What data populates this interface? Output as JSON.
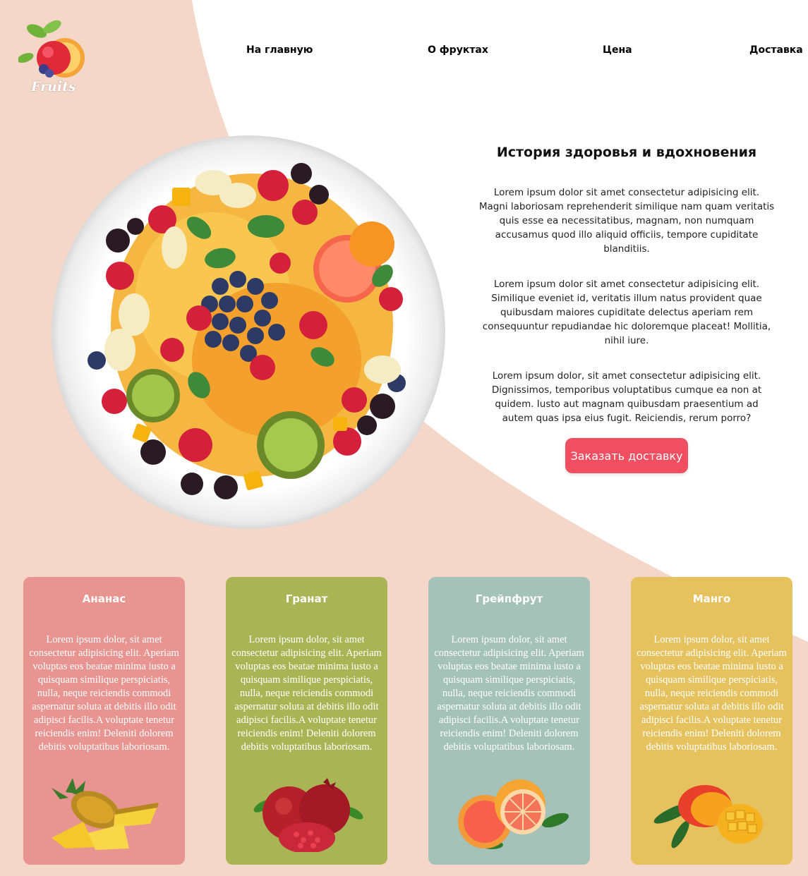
{
  "logo": {
    "text": "Fruits"
  },
  "nav": {
    "items": [
      {
        "label": "На главную"
      },
      {
        "label": "О фруктах"
      },
      {
        "label": "Цена"
      },
      {
        "label": "Доставка"
      }
    ]
  },
  "hero": {
    "title": "История здоровья и вдохновения",
    "paragraphs": [
      "Lorem ipsum dolor sit amet consectetur adipisicing elit. Magni laboriosam reprehenderit similique nam quam veritatis quis esse ea necessitatibus, magnam, non numquam accusamus quod illo aliquid officiis, tempore cupiditate blanditiis.",
      "Lorem ipsum dolor sit amet consectetur adipisicing elit. Similique eveniet id, veritatis illum natus provident quae quibusdam maiores cupiditate delectus aperiam rem consequuntur repudiandae hic doloremque placeat! Mollitia, nihil iure.",
      "Lorem ipsum dolor, sit amet consectetur adipisicing elit. Dignissimos, temporibus voluptatibus cumque ea non at quidem. Iusto aut magnam quibusdam praesentium ad autem quas ipsa eius fugit. Reiciendis, rerum porro?"
    ],
    "button_label": "Заказать доставку"
  },
  "cards": [
    {
      "title": "Ананас",
      "color": "#e89490",
      "text": "Lorem ipsum dolor, sit amet consectetur adipisicing elit. Aperiam voluptas eos beatae minima iusto a quisquam similique perspiciatis, nulla, neque reiciendis commodi aspernatur soluta at debitis illo odit adipisci facilis.A voluptate tenetur reiciendis enim! Deleniti dolorem debitis voluptatibus laboriosam.",
      "icon": "pineapple-image"
    },
    {
      "title": "Гранат",
      "color": "#a9b554",
      "text": "Lorem ipsum dolor, sit amet consectetur adipisicing elit. Aperiam voluptas eos beatae minima iusto a quisquam similique perspiciatis, nulla, neque reiciendis commodi aspernatur soluta at debitis illo odit adipisci facilis.A voluptate tenetur reiciendis enim! Deleniti dolorem debitis voluptatibus laboriosam.",
      "icon": "pomegranate-image"
    },
    {
      "title": "Грейпфрут",
      "color": "#a4c2b8",
      "text": "Lorem ipsum dolor, sit amet consectetur adipisicing elit. Aperiam voluptas eos beatae minima iusto a quisquam similique perspiciatis, nulla, neque reiciendis commodi aspernatur soluta at debitis illo odit adipisci facilis.A voluptate tenetur reiciendis enim! Deleniti dolorem debitis voluptatibus laboriosam.",
      "icon": "grapefruit-image"
    },
    {
      "title": "Манго",
      "color": "#e6c25e",
      "text": "Lorem ipsum dolor, sit amet consectetur adipisicing elit. Aperiam voluptas eos beatae minima iusto a quisquam similique perspiciatis, nulla, neque reiciendis commodi aspernatur soluta at debitis illo odit adipisci facilis.A voluptate tenetur reiciendis enim! Deleniti dolorem debitis voluptatibus laboriosam.",
      "icon": "mango-image"
    }
  ],
  "colors": {
    "background_shape": "#f4d7c8",
    "accent_button": "#f04e61"
  }
}
